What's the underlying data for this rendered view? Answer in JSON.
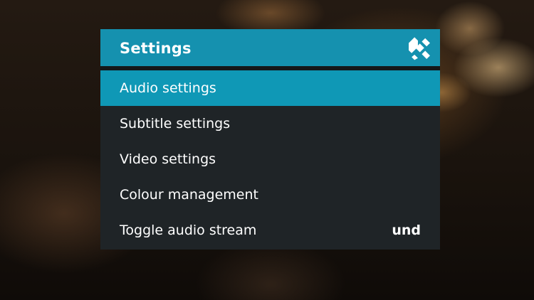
{
  "dialog": {
    "title": "Settings",
    "logo_icon": "kodi-logo-icon",
    "colors": {
      "header": "#1591af",
      "selected": "#0f98b6",
      "panel": "#1f2427"
    }
  },
  "menu": {
    "selected_index": 0,
    "items": [
      {
        "label": "Audio settings",
        "value": ""
      },
      {
        "label": "Subtitle settings",
        "value": ""
      },
      {
        "label": "Video settings",
        "value": ""
      },
      {
        "label": "Colour management",
        "value": ""
      },
      {
        "label": "Toggle audio stream",
        "value": "und"
      }
    ]
  }
}
